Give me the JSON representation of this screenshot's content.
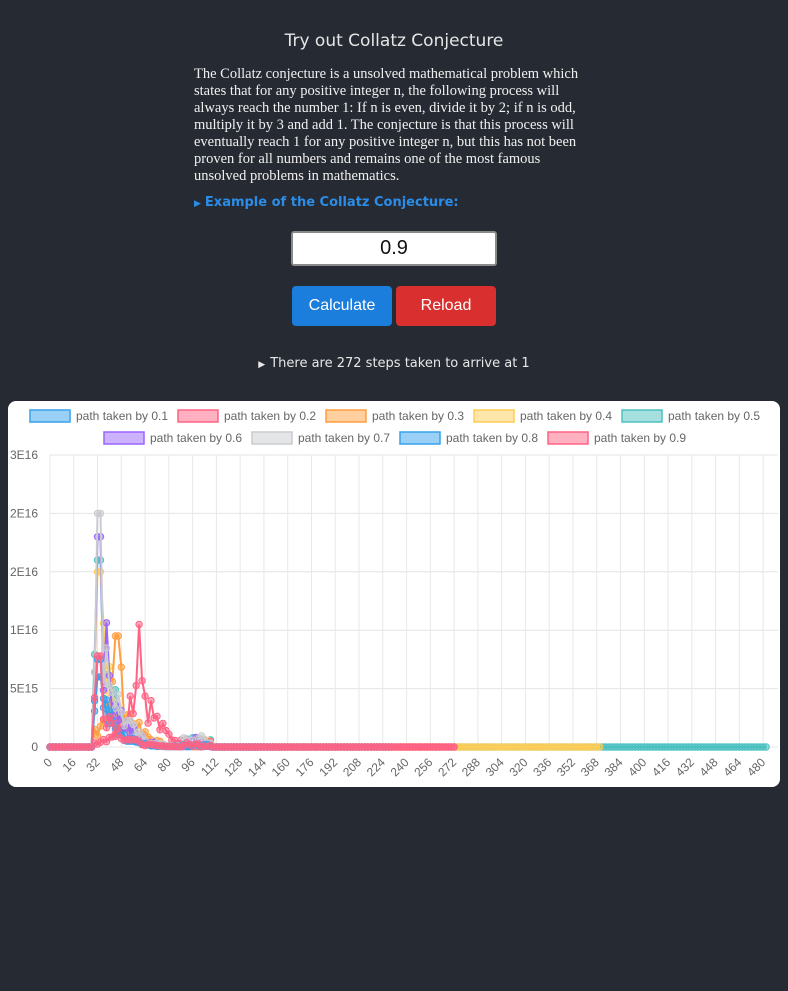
{
  "page": {
    "title": "Try out Collatz Conjecture",
    "description": "The Collatz conjecture is a unsolved mathematical problem which states that for any positive integer n, the following process will always reach the number 1: If n is even, divide it by 2; if n is odd, multiply it by 3 and add 1. The conjecture is that this process will eventually reach 1 for any positive integer n, but this has not been proven for all numbers and remains one of the most famous unsolved problems in mathematics.",
    "example_summary": "Example of the Collatz Conjecture:",
    "steps_summary": "There are 272 steps taken to arrive at 1"
  },
  "form": {
    "input_value": "0.9",
    "calculate_label": "Calculate",
    "reload_label": "Reload"
  },
  "colors": {
    "calculate": "#1b7ddc",
    "reload": "#d9302f",
    "link": "#2b8de8"
  },
  "chart_data": {
    "type": "line",
    "legend_position": "top",
    "grid": true,
    "series": [
      {
        "name": "path taken by 0.1",
        "color": "#36a2eb",
        "peak": 6000000000000000.0,
        "peak_x": 33,
        "length": 230
      },
      {
        "name": "path taken by 0.2",
        "color": "#ff6384",
        "peak": 1.05e+16,
        "peak_x": 60,
        "length": 272
      },
      {
        "name": "path taken by 0.3",
        "color": "#ff9f40",
        "peak": 9500000000000000.0,
        "peak_x": 45,
        "length": 260
      },
      {
        "name": "path taken by 0.4",
        "color": "#ffcd56",
        "peak": 1.5e+16,
        "peak_x": 33,
        "length": 370
      },
      {
        "name": "path taken by 0.5",
        "color": "#4bc0c0",
        "peak": 1.6e+16,
        "peak_x": 33,
        "length": 482
      },
      {
        "name": "path taken by 0.6",
        "color": "#9966ff",
        "peak": 1.8e+16,
        "peak_x": 33,
        "length": 140
      },
      {
        "name": "path taken by 0.7",
        "color": "#c9cbcf",
        "peak": 2e+16,
        "peak_x": 33,
        "length": 120
      },
      {
        "name": "path taken by 0.8",
        "color": "#36a2eb",
        "peak": 7500000000000000.0,
        "peak_x": 33,
        "length": 150
      },
      {
        "name": "path taken by 0.9",
        "color": "#ff6384",
        "peak": 7800000000000000.0,
        "peak_x": 33,
        "length": 272
      }
    ],
    "x_ticks": [
      "0",
      "16",
      "32",
      "48",
      "64",
      "80",
      "96",
      "112",
      "128",
      "144",
      "160",
      "176",
      "192",
      "208",
      "224",
      "240",
      "256",
      "272",
      "288",
      "304",
      "320",
      "336",
      "352",
      "368",
      "384",
      "400",
      "416",
      "432",
      "448",
      "464",
      "480"
    ],
    "y_ticks": [
      "0",
      "5E15",
      "1E16",
      "2E16",
      "2E16",
      "3E16"
    ],
    "ylim": [
      0,
      2.5e+16
    ],
    "xlim": [
      0,
      490
    ]
  }
}
